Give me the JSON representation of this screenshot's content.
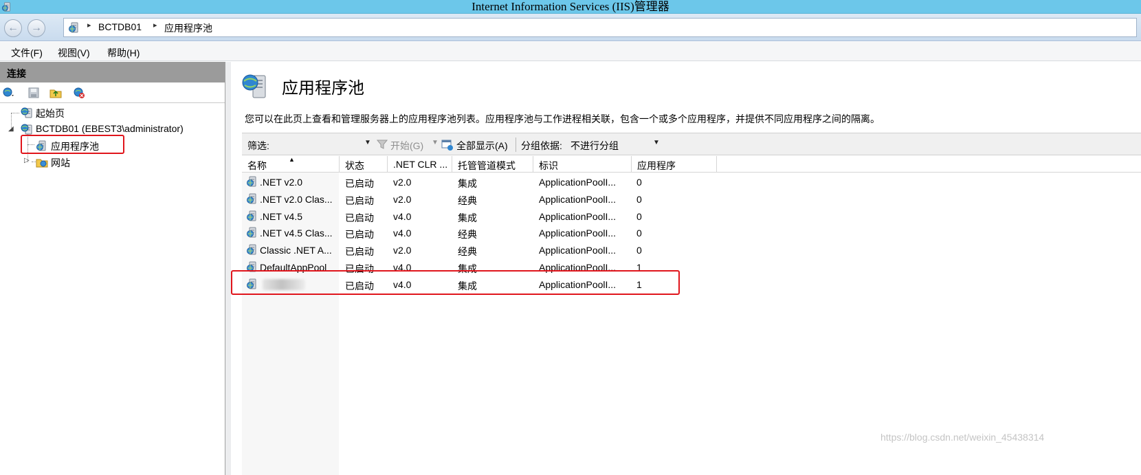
{
  "window": {
    "title": "Internet Information Services (IIS)管理器"
  },
  "nav": {
    "back_glyph": "←",
    "forward_glyph": "→",
    "breadcrumb": [
      "BCTDB01",
      "应用程序池"
    ],
    "separator_glyph": "▸"
  },
  "menu": [
    "文件(F)",
    "视图(V)",
    "帮助(H)"
  ],
  "connections": {
    "header": "连接",
    "tree": {
      "start_page": "起始页",
      "server": "BCTDB01 (EBEST3\\administrator)",
      "app_pools": "应用程序池",
      "sites": "网站"
    }
  },
  "main": {
    "title": "应用程序池",
    "description": "您可以在此页上查看和管理服务器上的应用程序池列表。应用程序池与工作进程相关联，包含一个或多个应用程序，并提供不同应用程序之间的隔离。",
    "filter": {
      "label": "筛选:",
      "start_label": "开始(G)",
      "show_all_label": "全部显示(A)",
      "group_by_label": "分组依据:",
      "group_by_value": "不进行分组"
    },
    "columns": [
      "名称",
      "状态",
      ".NET CLR ...",
      "托管管道模式",
      "标识",
      "应用程序"
    ],
    "rows": [
      {
        "name": ".NET v2.0",
        "status": "已启动",
        "clr": "v2.0",
        "pipeline": "集成",
        "identity": "ApplicationPoolI...",
        "apps": "0"
      },
      {
        "name": ".NET v2.0 Clas...",
        "status": "已启动",
        "clr": "v2.0",
        "pipeline": "经典",
        "identity": "ApplicationPoolI...",
        "apps": "0"
      },
      {
        "name": ".NET v4.5",
        "status": "已启动",
        "clr": "v4.0",
        "pipeline": "集成",
        "identity": "ApplicationPoolI...",
        "apps": "0"
      },
      {
        "name": ".NET v4.5 Clas...",
        "status": "已启动",
        "clr": "v4.0",
        "pipeline": "经典",
        "identity": "ApplicationPoolI...",
        "apps": "0"
      },
      {
        "name": "Classic .NET A...",
        "status": "已启动",
        "clr": "v2.0",
        "pipeline": "经典",
        "identity": "ApplicationPoolI...",
        "apps": "0"
      },
      {
        "name": "DefaultAppPool",
        "status": "已启动",
        "clr": "v4.0",
        "pipeline": "集成",
        "identity": "ApplicationPoolI...",
        "apps": "1"
      },
      {
        "name": "",
        "status": "已启动",
        "clr": "v4.0",
        "pipeline": "集成",
        "identity": "ApplicationPoolI...",
        "apps": "1"
      }
    ]
  },
  "watermark": "https://blog.csdn.net/weixin_45438314",
  "colors": {
    "titlebar": "#6cc7ea",
    "highlight_box": "#e0141b",
    "panel_header": "#9b9b9b"
  },
  "icons": [
    "iis-manager-icon",
    "server-globe-icon",
    "app-pool-icon",
    "folder-globe-icon",
    "filter-funnel-icon",
    "show-all-icon",
    "save-icon",
    "connect-icon"
  ]
}
